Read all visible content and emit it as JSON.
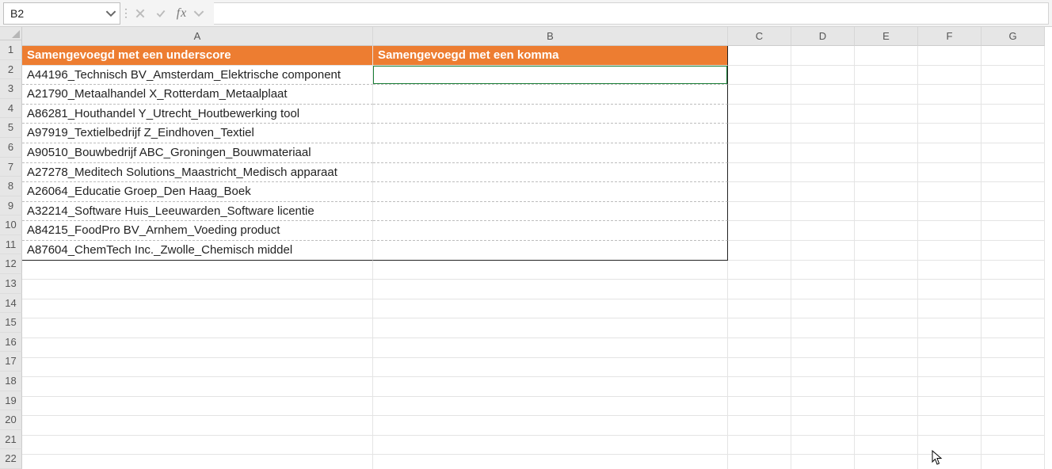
{
  "nameBox": {
    "value": "B2"
  },
  "formulaBar": {
    "value": ""
  },
  "columns": [
    "A",
    "B",
    "C",
    "D",
    "E",
    "F",
    "G"
  ],
  "rowNumbers": [
    1,
    2,
    3,
    4,
    5,
    6,
    7,
    8,
    9,
    10,
    11,
    12,
    13,
    14,
    15,
    16,
    17,
    18,
    19,
    20,
    21,
    22
  ],
  "headers": {
    "A": "Samengevoegd met een underscore",
    "B": "Samengevoegd met een komma"
  },
  "dataA": [
    "A44196_Technisch BV_Amsterdam_Elektrische component",
    "A21790_Metaalhandel X_Rotterdam_Metaalplaat",
    "A86281_Houthandel Y_Utrecht_Houtbewerking tool",
    "A97919_Textielbedrijf Z_Eindhoven_Textiel",
    "A90510_Bouwbedrijf ABC_Groningen_Bouwmateriaal",
    "A27278_Meditech Solutions_Maastricht_Medisch apparaat",
    "A26064_Educatie Groep_Den Haag_Boek",
    "A32214_Software Huis_Leeuwarden_Software licentie",
    "A84215_FoodPro BV_Arnhem_Voeding product",
    "A87604_ChemTech Inc._Zwolle_Chemisch middel"
  ],
  "activeCell": "B2"
}
